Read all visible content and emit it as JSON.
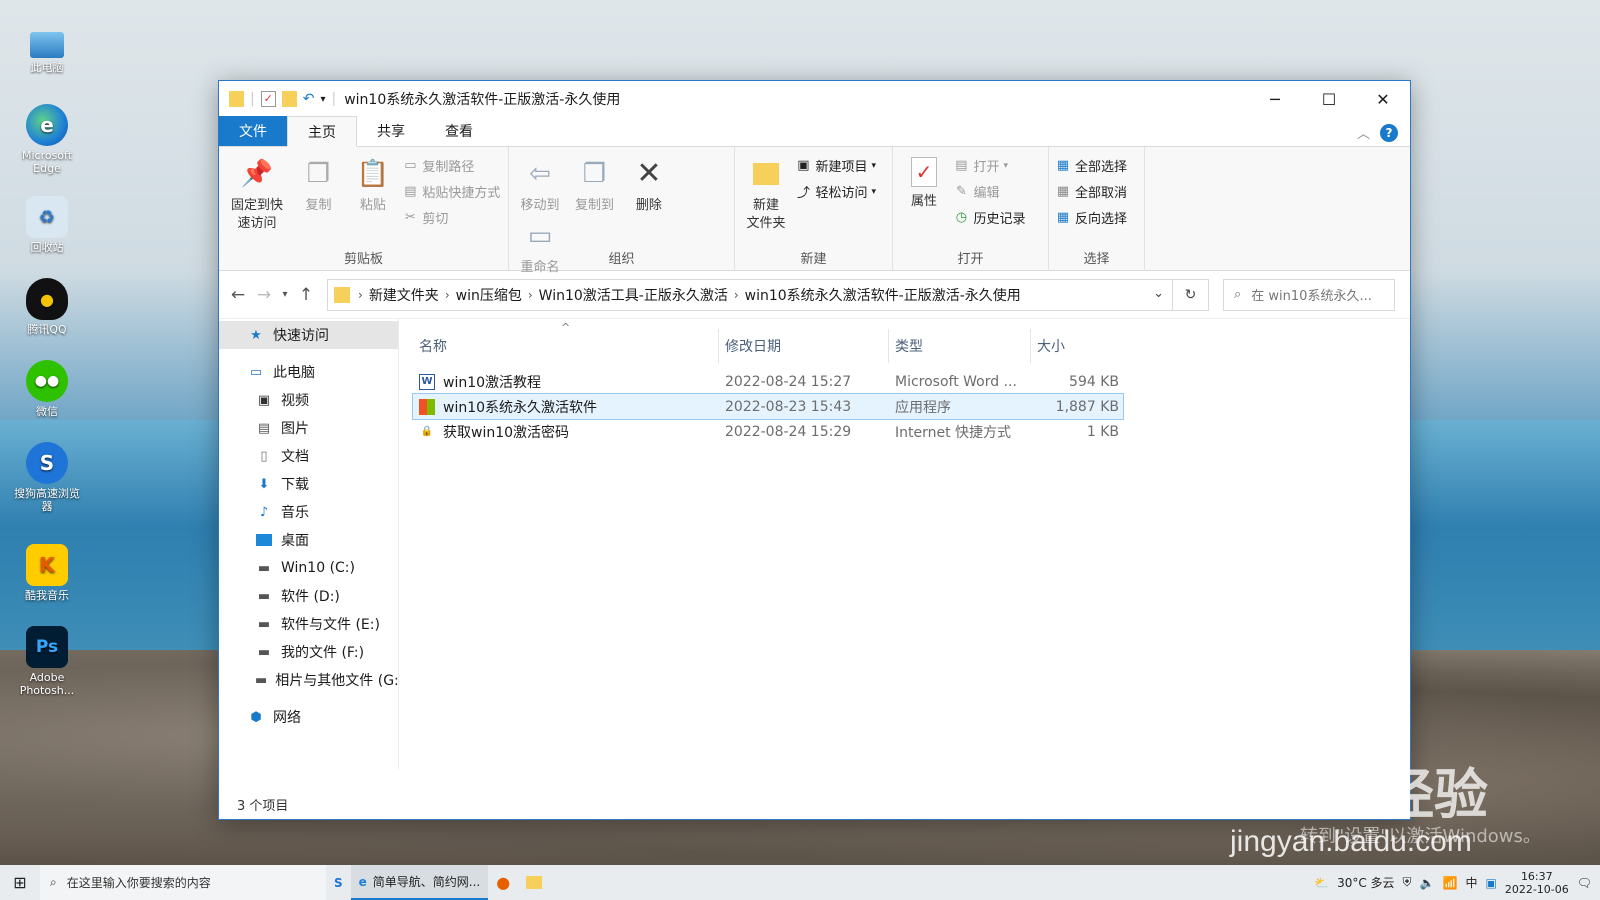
{
  "desktop": {
    "icons": [
      {
        "label": "此电脑",
        "icon": "computer-icon"
      },
      {
        "label": "Microsoft Edge",
        "icon": "edge-icon"
      },
      {
        "label": "回收站",
        "icon": "recycle-bin-icon"
      },
      {
        "label": "腾讯QQ",
        "icon": "qq-icon"
      },
      {
        "label": "微信",
        "icon": "wechat-icon"
      },
      {
        "label": "搜狗高速浏览器",
        "icon": "sogou-browser-icon"
      },
      {
        "label": "酷我音乐",
        "icon": "kuwo-music-icon"
      },
      {
        "label": "Adobe Photosh...",
        "icon": "photoshop-icon"
      }
    ]
  },
  "window": {
    "title": "win10系统永久激活软件-正版激活-永久使用",
    "controls": {
      "minimize": "─",
      "maximize": "☐",
      "close": "✕"
    },
    "tabs": [
      "文件",
      "主页",
      "共享",
      "查看"
    ],
    "help": "?",
    "ribbon": {
      "clipboard": {
        "name": "剪贴板",
        "pin": "固定到快速访问",
        "pin_l1": "固定到快",
        "pin_l2": "速访问",
        "copy": "复制",
        "paste": "粘贴",
        "copy_path": "复制路径",
        "paste_shortcut": "粘贴快捷方式",
        "cut": "剪切"
      },
      "organize": {
        "name": "组织",
        "move_to": "移动到",
        "copy_to": "复制到",
        "delete": "删除",
        "rename": "重命名"
      },
      "new": {
        "name": "新建",
        "new_folder_l1": "新建",
        "new_folder_l2": "文件夹",
        "new_item": "新建项目",
        "easy_access": "轻松访问"
      },
      "open": {
        "name": "打开",
        "properties": "属性",
        "open": "打开",
        "edit": "编辑",
        "history": "历史记录"
      },
      "select": {
        "name": "选择",
        "select_all": "全部选择",
        "select_none": "全部取消",
        "invert": "反向选择"
      }
    },
    "address": {
      "crumbs": [
        "新建文件夹",
        "win压缩包",
        "Win10激活工具-正版永久激活",
        "win10系统永久激活软件-正版激活-永久使用"
      ],
      "search_placeholder": "在 win10系统永久..."
    },
    "nav_pane": [
      {
        "label": "快速访问",
        "icon": "star-icon",
        "level": 0,
        "selected": true
      },
      {
        "label": "此电脑",
        "icon": "computer-icon",
        "level": 0
      },
      {
        "label": "视频",
        "icon": "video-icon",
        "level": 1
      },
      {
        "label": "图片",
        "icon": "pictures-icon",
        "level": 1
      },
      {
        "label": "文档",
        "icon": "documents-icon",
        "level": 1
      },
      {
        "label": "下载",
        "icon": "download-icon",
        "level": 1
      },
      {
        "label": "音乐",
        "icon": "music-icon",
        "level": 1
      },
      {
        "label": "桌面",
        "icon": "desktop-icon",
        "level": 1
      },
      {
        "label": "Win10 (C:)",
        "icon": "drive-icon",
        "level": 1
      },
      {
        "label": "软件 (D:)",
        "icon": "drive-icon",
        "level": 1
      },
      {
        "label": "软件与文件 (E:)",
        "icon": "drive-icon",
        "level": 1
      },
      {
        "label": "我的文件 (F:)",
        "icon": "drive-icon",
        "level": 1
      },
      {
        "label": "相片与其他文件 (G:",
        "icon": "drive-icon",
        "level": 1
      },
      {
        "label": "网络",
        "icon": "network-icon",
        "level": 0
      }
    ],
    "columns": {
      "name": "名称",
      "date": "修改日期",
      "type": "类型",
      "size": "大小"
    },
    "files": [
      {
        "name": "win10激活教程",
        "date": "2022-08-24 15:27",
        "type": "Microsoft Word ...",
        "size": "594 KB",
        "icon": "word-doc-icon"
      },
      {
        "name": "win10系统永久激活软件",
        "date": "2022-08-23 15:43",
        "type": "应用程序",
        "size": "1,887 KB",
        "icon": "app-icon",
        "selected": true
      },
      {
        "name": "获取win10激活密码",
        "date": "2022-08-24 15:29",
        "type": "Internet 快捷方式",
        "size": "1 KB",
        "icon": "internet-shortcut-icon"
      }
    ],
    "status": "3 个项目"
  },
  "watermark": {
    "logo": "Baidu经验",
    "url": "jingyan.baidu.com",
    "overlay": "转到\"设置\"以激活Windows。"
  },
  "taskbar": {
    "search_placeholder": "在这里输入你要搜索的内容",
    "active_app": "简单导航、简约网...",
    "weather": "30°C 多云",
    "ime": "中",
    "time": "16:37",
    "date": "2022-10-06"
  }
}
